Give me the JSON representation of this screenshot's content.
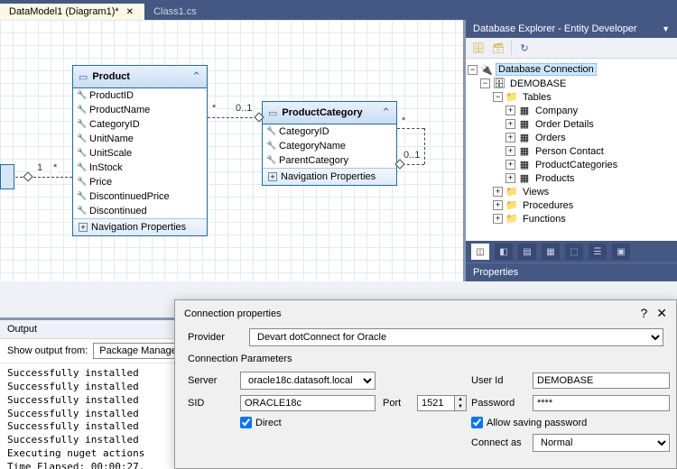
{
  "tabs": [
    {
      "label": "DataModel1 (Diagram1)*",
      "active": true,
      "closable": true
    },
    {
      "label": "Class1.cs",
      "active": false,
      "closable": false
    }
  ],
  "entities": {
    "product": {
      "title": "Product",
      "fields": [
        "ProductID",
        "ProductName",
        "CategoryID",
        "UnitName",
        "UnitScale",
        "InStock",
        "Price",
        "DiscontinuedPrice",
        "Discontinued"
      ],
      "nav": "Navigation Properties"
    },
    "productCategory": {
      "title": "ProductCategory",
      "fields": [
        "CategoryID",
        "CategoryName",
        "ParentCategory"
      ],
      "nav": "Navigation Properties"
    }
  },
  "cardinality": {
    "star": "*",
    "one": "1",
    "zeroOne": "0..1"
  },
  "dbx": {
    "title": "Database Explorer - Entity Developer",
    "root": "Database Connection",
    "db": "DEMOBASE",
    "tablesNode": "Tables",
    "tables": [
      "Company",
      "Order Details",
      "Orders",
      "Person Contact",
      "ProductCategories",
      "Products"
    ],
    "views": "Views",
    "procedures": "Procedures",
    "functions": "Functions",
    "propertiesPanel": "Properties"
  },
  "output": {
    "title": "Output",
    "showLabel": "Show output from:",
    "source": "Package Manager",
    "lines": [
      "Successfully installed",
      "Successfully installed",
      "Successfully installed",
      "Successfully installed",
      "Successfully installed",
      "Successfully installed",
      "Executing nuget actions",
      "Time Elapsed: 00:00:27."
    ]
  },
  "dialog": {
    "title": "Connection properties",
    "providerLabel": "Provider",
    "provider": "Devart dotConnect for Oracle",
    "paramsTitle": "Connection Parameters",
    "serverLabel": "Server",
    "server": "oracle18c.datasoft.local",
    "sidLabel": "SID",
    "sid": "ORACLE18c",
    "portLabel": "Port",
    "port": "1521",
    "directLabel": "Direct",
    "directChecked": true,
    "userLabel": "User Id",
    "user": "DEMOBASE",
    "passwordLabel": "Password",
    "password": "****",
    "allowSaveLabel": "Allow saving password",
    "allowSaveChecked": true,
    "connectAsLabel": "Connect as",
    "connectAs": "Normal"
  }
}
